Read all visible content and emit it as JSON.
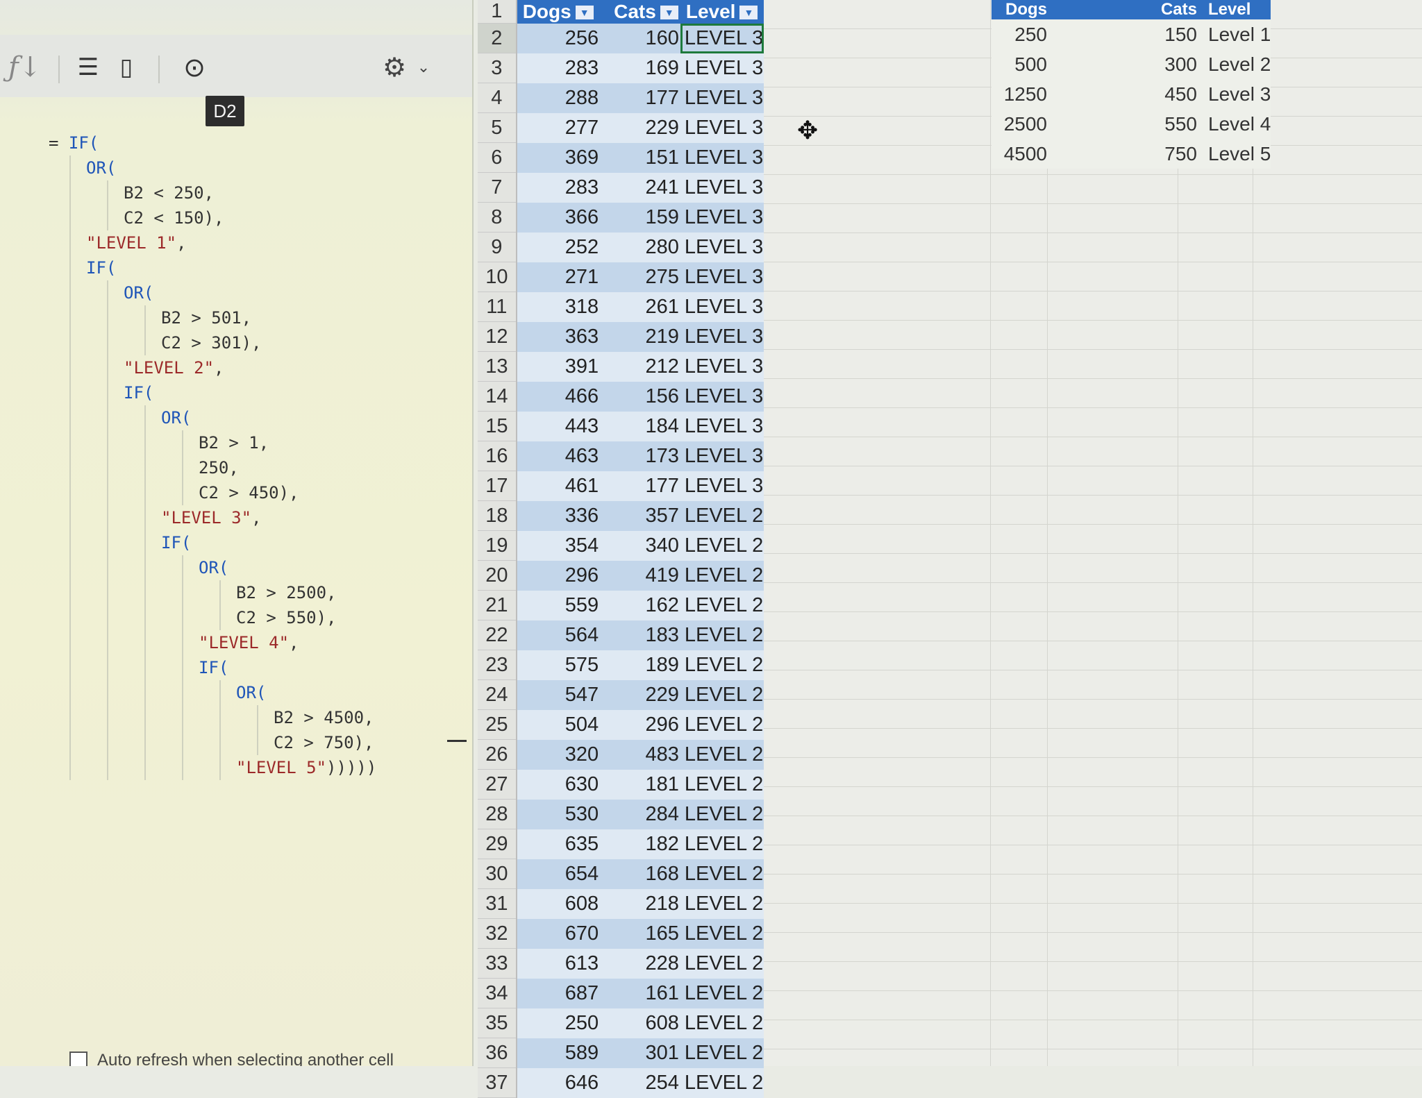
{
  "formula_pane": {
    "cell_reference": "D2",
    "toolbar": {
      "icons": [
        "function-icon",
        "format-icon",
        "paste-icon",
        "focus-icon",
        "settings-icon"
      ]
    },
    "lines": [
      {
        "indent": 0,
        "parts": [
          {
            "t": "plain",
            "v": "= "
          },
          {
            "t": "kw",
            "v": "IF("
          }
        ]
      },
      {
        "indent": 1,
        "parts": [
          {
            "t": "kw",
            "v": "OR("
          }
        ]
      },
      {
        "indent": 2,
        "parts": [
          {
            "t": "plain",
            "v": "B2 < 250,"
          }
        ]
      },
      {
        "indent": 2,
        "parts": [
          {
            "t": "plain",
            "v": "C2 < 150),"
          }
        ]
      },
      {
        "indent": 1,
        "parts": [
          {
            "t": "str",
            "v": "\"LEVEL 1\""
          },
          {
            "t": "plain",
            "v": ","
          }
        ]
      },
      {
        "indent": 1,
        "parts": [
          {
            "t": "kw",
            "v": "IF("
          }
        ]
      },
      {
        "indent": 2,
        "parts": [
          {
            "t": "kw",
            "v": "OR("
          }
        ]
      },
      {
        "indent": 3,
        "parts": [
          {
            "t": "plain",
            "v": "B2 > 501,"
          }
        ]
      },
      {
        "indent": 3,
        "parts": [
          {
            "t": "plain",
            "v": "C2 > 301),"
          }
        ]
      },
      {
        "indent": 2,
        "parts": [
          {
            "t": "str",
            "v": "\"LEVEL 2\""
          },
          {
            "t": "plain",
            "v": ","
          }
        ]
      },
      {
        "indent": 2,
        "parts": [
          {
            "t": "kw",
            "v": "IF("
          }
        ]
      },
      {
        "indent": 3,
        "parts": [
          {
            "t": "kw",
            "v": "OR("
          }
        ]
      },
      {
        "indent": 4,
        "parts": [
          {
            "t": "plain",
            "v": "B2 > 1,"
          }
        ]
      },
      {
        "indent": 4,
        "parts": [
          {
            "t": "plain",
            "v": "250,"
          }
        ]
      },
      {
        "indent": 4,
        "parts": [
          {
            "t": "plain",
            "v": "C2 > 450),"
          }
        ]
      },
      {
        "indent": 3,
        "parts": [
          {
            "t": "str",
            "v": "\"LEVEL 3\""
          },
          {
            "t": "plain",
            "v": ","
          }
        ]
      },
      {
        "indent": 3,
        "parts": [
          {
            "t": "kw",
            "v": "IF("
          }
        ]
      },
      {
        "indent": 4,
        "parts": [
          {
            "t": "kw",
            "v": "OR("
          }
        ]
      },
      {
        "indent": 5,
        "parts": [
          {
            "t": "plain",
            "v": "B2 > 2500,"
          }
        ]
      },
      {
        "indent": 5,
        "parts": [
          {
            "t": "plain",
            "v": "C2 > 550),"
          }
        ]
      },
      {
        "indent": 4,
        "parts": [
          {
            "t": "str",
            "v": "\"LEVEL 4\""
          },
          {
            "t": "plain",
            "v": ","
          }
        ]
      },
      {
        "indent": 4,
        "parts": [
          {
            "t": "kw",
            "v": "IF("
          }
        ]
      },
      {
        "indent": 5,
        "parts": [
          {
            "t": "kw",
            "v": "OR("
          }
        ]
      },
      {
        "indent": 6,
        "parts": [
          {
            "t": "plain",
            "v": "B2 > 4500,"
          }
        ]
      },
      {
        "indent": 6,
        "parts": [
          {
            "t": "plain",
            "v": "C2 > 750),"
          }
        ]
      },
      {
        "indent": 5,
        "parts": [
          {
            "t": "str",
            "v": "\"LEVEL 5\""
          },
          {
            "t": "plain",
            "v": ")))))"
          }
        ]
      }
    ],
    "auto_refresh_label": "Auto refresh when selecting another cell"
  },
  "sheet": {
    "headers": {
      "row": "1",
      "dogs": "Dogs",
      "cats": "Cats",
      "level": "Level"
    },
    "selected_row": "2",
    "rows": [
      [
        "2",
        "256",
        "160",
        "LEVEL 3"
      ],
      [
        "3",
        "283",
        "169",
        "LEVEL 3"
      ],
      [
        "4",
        "288",
        "177",
        "LEVEL 3"
      ],
      [
        "5",
        "277",
        "229",
        "LEVEL 3"
      ],
      [
        "6",
        "369",
        "151",
        "LEVEL 3"
      ],
      [
        "7",
        "283",
        "241",
        "LEVEL 3"
      ],
      [
        "8",
        "366",
        "159",
        "LEVEL 3"
      ],
      [
        "9",
        "252",
        "280",
        "LEVEL 3"
      ],
      [
        "10",
        "271",
        "275",
        "LEVEL 3"
      ],
      [
        "11",
        "318",
        "261",
        "LEVEL 3"
      ],
      [
        "12",
        "363",
        "219",
        "LEVEL 3"
      ],
      [
        "13",
        "391",
        "212",
        "LEVEL 3"
      ],
      [
        "14",
        "466",
        "156",
        "LEVEL 3"
      ],
      [
        "15",
        "443",
        "184",
        "LEVEL 3"
      ],
      [
        "16",
        "463",
        "173",
        "LEVEL 3"
      ],
      [
        "17",
        "461",
        "177",
        "LEVEL 3"
      ],
      [
        "18",
        "336",
        "357",
        "LEVEL 2"
      ],
      [
        "19",
        "354",
        "340",
        "LEVEL 2"
      ],
      [
        "20",
        "296",
        "419",
        "LEVEL 2"
      ],
      [
        "21",
        "559",
        "162",
        "LEVEL 2"
      ],
      [
        "22",
        "564",
        "183",
        "LEVEL 2"
      ],
      [
        "23",
        "575",
        "189",
        "LEVEL 2"
      ],
      [
        "24",
        "547",
        "229",
        "LEVEL 2"
      ],
      [
        "25",
        "504",
        "296",
        "LEVEL 2"
      ],
      [
        "26",
        "320",
        "483",
        "LEVEL 2"
      ],
      [
        "27",
        "630",
        "181",
        "LEVEL 2"
      ],
      [
        "28",
        "530",
        "284",
        "LEVEL 2"
      ],
      [
        "29",
        "635",
        "182",
        "LEVEL 2"
      ],
      [
        "30",
        "654",
        "168",
        "LEVEL 2"
      ],
      [
        "31",
        "608",
        "218",
        "LEVEL 2"
      ],
      [
        "32",
        "670",
        "165",
        "LEVEL 2"
      ],
      [
        "33",
        "613",
        "228",
        "LEVEL 2"
      ],
      [
        "34",
        "687",
        "161",
        "LEVEL 2"
      ],
      [
        "35",
        "250",
        "608",
        "LEVEL 2"
      ],
      [
        "36",
        "589",
        "301",
        "LEVEL 2"
      ],
      [
        "37",
        "646",
        "254",
        "LEVEL 2"
      ]
    ]
  },
  "lookup": {
    "headers": {
      "dogs": "Dogs",
      "cats": "Cats",
      "level": "Level"
    },
    "rows": [
      [
        "250",
        "150",
        "Level 1"
      ],
      [
        "500",
        "300",
        "Level 2"
      ],
      [
        "1250",
        "450",
        "Level 3"
      ],
      [
        "2500",
        "550",
        "Level 4"
      ],
      [
        "4500",
        "750",
        "Level 5"
      ]
    ]
  },
  "colors": {
    "header_blue": "#2f6fc2",
    "band_dark": "#c3d6ea",
    "band_light": "#dfe9f3",
    "selection_green": "#1e7a3c",
    "keyword_blue": "#1f55b8",
    "string_red": "#9c2a2a"
  }
}
